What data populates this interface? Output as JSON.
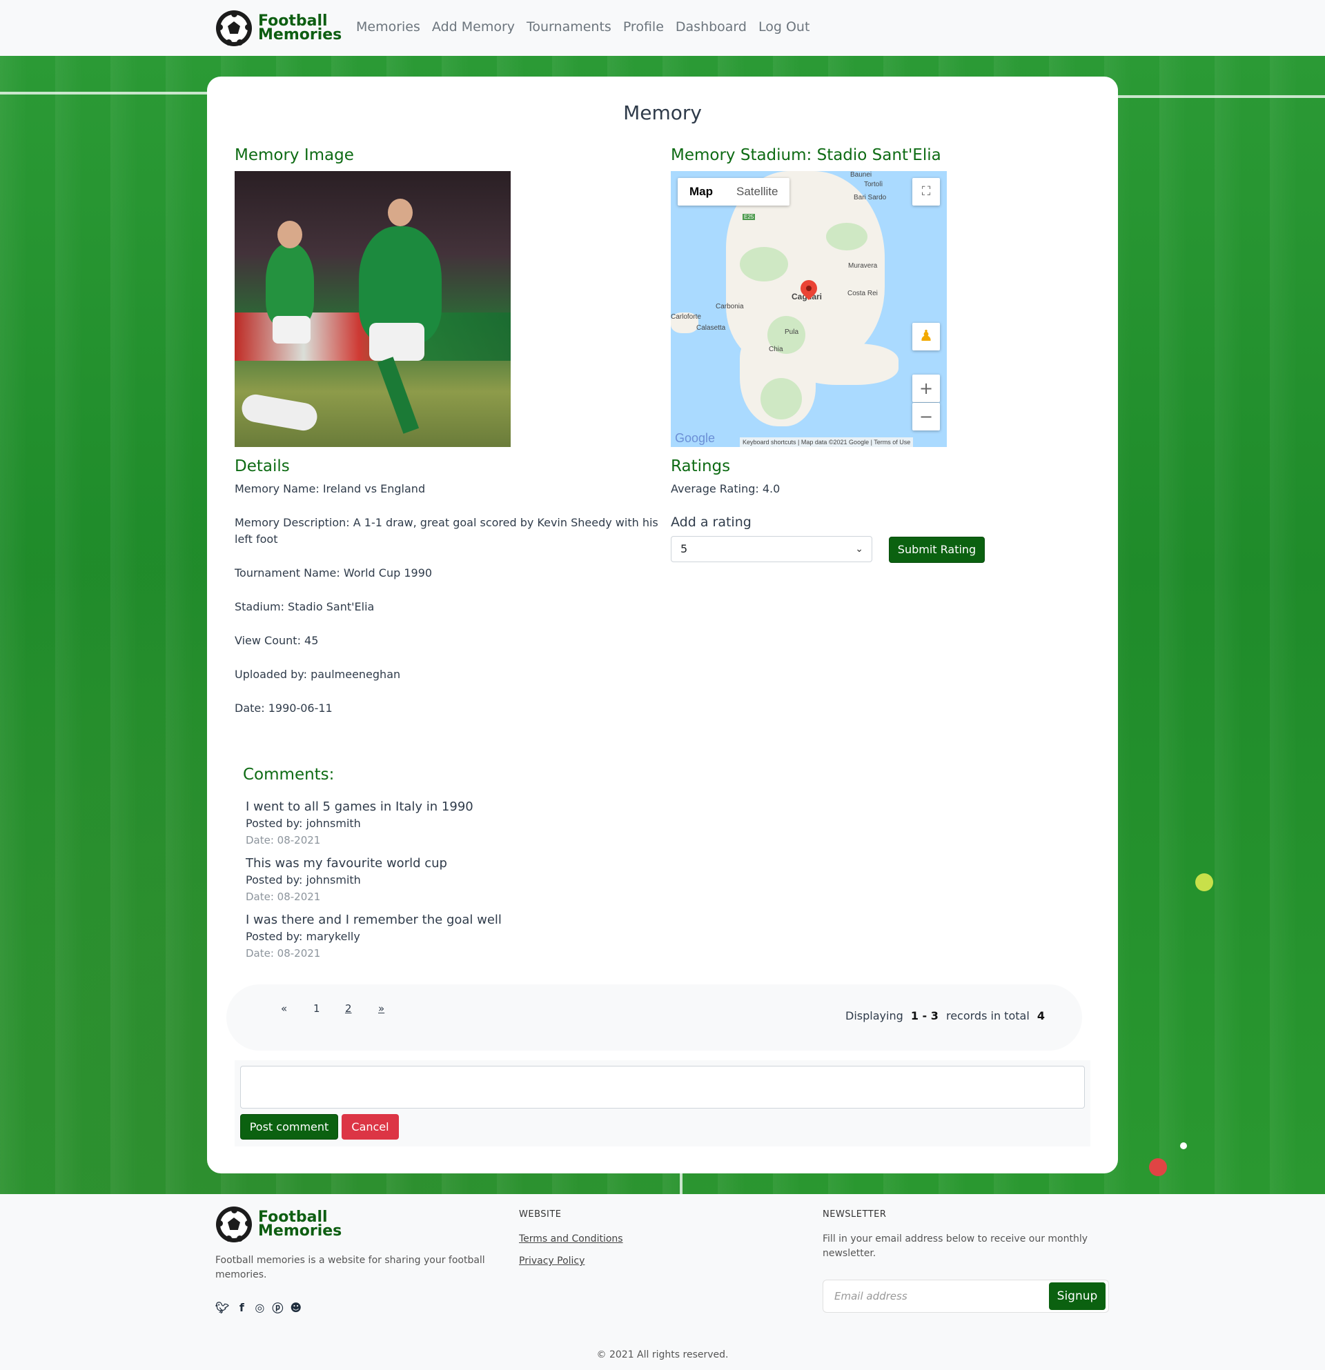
{
  "brand": {
    "line1": "Football",
    "line2": "Memories"
  },
  "nav": [
    "Memories",
    "Add Memory",
    "Tournaments",
    "Profile",
    "Dashboard",
    "Log Out"
  ],
  "page": {
    "title": "Memory",
    "image_heading": "Memory Image",
    "stadium_heading": "Memory Stadium: Stadio Sant'Elia",
    "details_heading": "Details",
    "ratings_heading": "Ratings"
  },
  "map": {
    "tabs": {
      "map": "Map",
      "satellite": "Satellite"
    },
    "labels": [
      "Baunei",
      "Tortolì",
      "Bari Sardo",
      "Muravera",
      "Costa Rei",
      "Cagliari",
      "Carbonia",
      "Carloforte",
      "Calasetta",
      "Pula",
      "Chia",
      "E25"
    ],
    "footer": "Keyboard shortcuts  |  Map data ©2021 Google  |  Terms of Use",
    "logo": "Google"
  },
  "details": [
    "Memory Name: Ireland vs England",
    "Memory Description: A 1-1 draw, great goal scored by Kevin Sheedy with his",
    "left foot",
    "Tournament Name: World Cup 1990",
    "Stadium: Stadio Sant'Elia",
    "View Count: 45",
    "Uploaded by: paulmeeneghan",
    "Date: 1990-06-11"
  ],
  "ratings": {
    "average": "Average Rating: 4.0",
    "add_label": "Add a rating",
    "selected": "5",
    "submit": "Submit Rating"
  },
  "comments": {
    "title": "Comments:",
    "items": [
      {
        "text": "I went to all 5 games in Italy in 1990",
        "by": "Posted by: johnsmith",
        "date": "Date: 08-2021"
      },
      {
        "text": "This was my favourite world cup",
        "by": "Posted by: johnsmith",
        "date": "Date: 08-2021"
      },
      {
        "text": "I was there and I remember the goal well",
        "by": "Posted by: marykelly",
        "date": "Date: 08-2021"
      }
    ]
  },
  "pagination": {
    "prev": "«",
    "pages": [
      "1",
      "2"
    ],
    "next": "»",
    "summary_prefix": "Displaying",
    "range": "1 - 3",
    "summary_mid": "records in total",
    "total": "4"
  },
  "comment_form": {
    "post": "Post comment",
    "cancel": "Cancel"
  },
  "footer": {
    "description": "Football memories is a website for sharing your football memories.",
    "website_heading": "WEBSITE",
    "links": [
      "Terms and Conditions",
      "Privacy Policy"
    ],
    "newsletter_heading": "NEWSLETTER",
    "newsletter_desc": "Fill in your email address below to receive our monthly newsletter.",
    "email_placeholder": "Email address",
    "signup": "Signup",
    "copyright": "© 2021 All rights reserved.",
    "social_icons": [
      "twitter-icon",
      "facebook-icon",
      "instagram-icon",
      "pinterest-icon",
      "snapchat-icon"
    ]
  },
  "colors": {
    "brand_green": "#0b6110",
    "cancel_red": "#dc3545",
    "heading_green": "#0e6b14"
  }
}
